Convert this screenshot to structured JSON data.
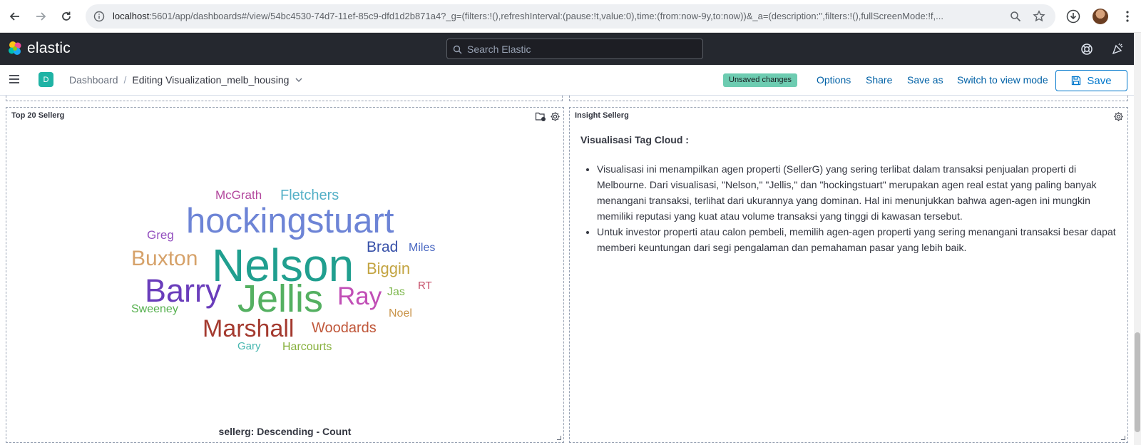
{
  "browser": {
    "url_host": "localhost",
    "url_rest": ":5601/app/dashboards#/view/54bc4530-74d7-11ef-85c9-dfd1d2b871a4?_g=(filters:!(),refreshInterval:(pause:!t,value:0),time:(from:now-9y,to:now))&_a=(description:'',filters:!(),fullScreenMode:!f,..."
  },
  "header": {
    "logo_text": "elastic",
    "search_placeholder": "Search Elastic"
  },
  "toolbar": {
    "space_initial": "D",
    "breadcrumb_root": "Dashboard",
    "breadcrumb_sep": "/",
    "breadcrumb_current": "Editing Visualization_melb_housing",
    "unsaved": "Unsaved changes",
    "options": "Options",
    "share": "Share",
    "save_as": "Save as",
    "switch_mode": "Switch to view mode",
    "save": "Save"
  },
  "left_panel": {
    "title": "Top 20 Sellerg",
    "axis_label": "sellerg: Descending - Count"
  },
  "chart_data": {
    "type": "tagcloud",
    "words": [
      {
        "text": "Nelson",
        "color": "#209f8f"
      },
      {
        "text": "hockingstuart",
        "color": "#6d84d6"
      },
      {
        "text": "Jellis",
        "color": "#54b061"
      },
      {
        "text": "Barry",
        "color": "#6a3dbb"
      },
      {
        "text": "Marshall",
        "color": "#a43a2f"
      },
      {
        "text": "Ray",
        "color": "#c14fb6"
      },
      {
        "text": "Buxton",
        "color": "#d6a26a"
      },
      {
        "text": "Fletchers",
        "color": "#54b0c7"
      },
      {
        "text": "Biggin",
        "color": "#c3a441"
      },
      {
        "text": "Woodards",
        "color": "#c0573a"
      },
      {
        "text": "Brad",
        "color": "#3750a8"
      },
      {
        "text": "McGrath",
        "color": "#b3479d"
      },
      {
        "text": "Greg",
        "color": "#9350bf"
      },
      {
        "text": "Miles",
        "color": "#4a68c2"
      },
      {
        "text": "Sweeney",
        "color": "#55b04e"
      },
      {
        "text": "Jas",
        "color": "#7fb84f"
      },
      {
        "text": "Noel",
        "color": "#c9944a"
      },
      {
        "text": "RT",
        "color": "#c54d67"
      },
      {
        "text": "Harcourts",
        "color": "#87b03d"
      },
      {
        "text": "Gary",
        "color": "#48b7b0"
      }
    ]
  },
  "right_panel": {
    "title": "Insight Sellerg",
    "heading": "Visualisasi Tag Cloud :",
    "bullets": [
      "Visualisasi ini menampilkan agen properti (SellerG) yang sering terlibat dalam transaksi penjualan properti di Melbourne. Dari visualisasi, \"Nelson,\" \"Jellis,\" dan \"hockingstuart\" merupakan agen real estat yang paling banyak menangani transaksi, terlihat dari ukurannya yang dominan. Hal ini menunjukkan bahwa agen-agen ini mungkin memiliki reputasi yang kuat atau volume transaksi yang tinggi di kawasan tersebut.",
      "Untuk investor properti atau calon pembeli, memilih agen-agen properti yang sering menangani transaksi besar dapat memberi keuntungan dari segi pengalaman dan pemahaman pasar yang lebih baik."
    ]
  }
}
